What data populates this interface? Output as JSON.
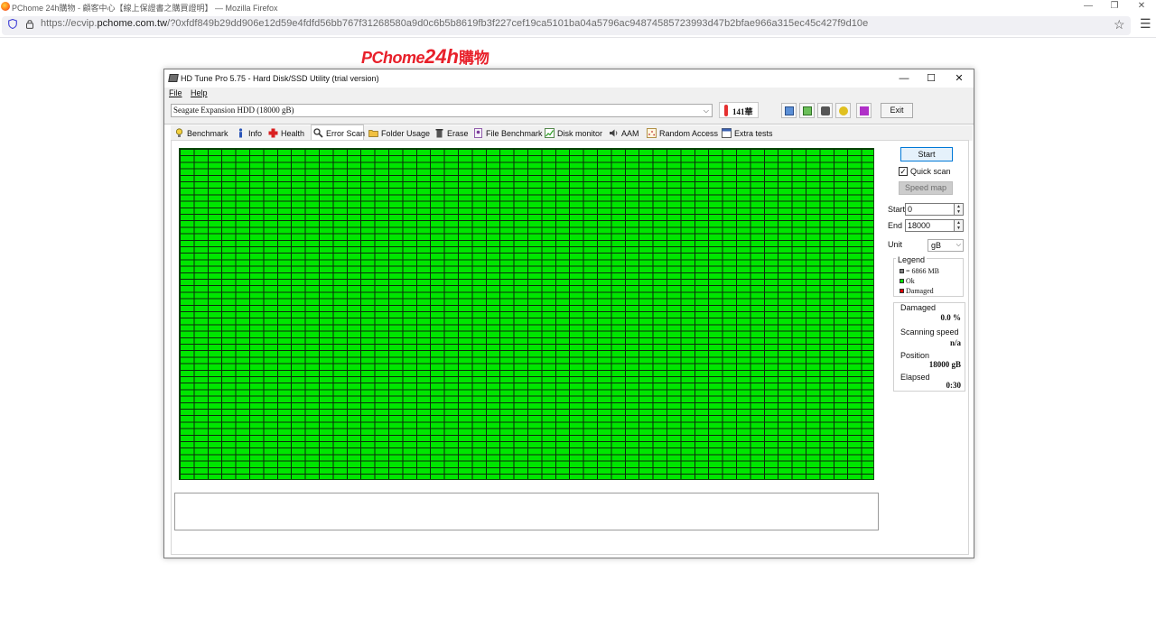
{
  "browser": {
    "title": "PChome 24h購物 - 顧客中心【線上保證書之購買證明】 — Mozilla Firefox",
    "url_host": "https://ecvip.pchome.com.tw",
    "url_host_pre": "https://ecvip.",
    "url_host_domain": "pchome.com.tw",
    "url_path": "/?0xfdf849b29dd906e12d59e4fdfd56bb767f31268580a9d0c6b5b8619fb3f227cef19ca5101ba04a5796ac94874585723993d47b2bfae966a315ec45c427f9d10e",
    "controls": {
      "minimize": "—",
      "restore": "❐",
      "close": "✕"
    },
    "star_icon": "☆",
    "menu_icon": "☰"
  },
  "page": {
    "logo_pc": "PChome",
    "logo_24": "24h",
    "logo_shop": "購物",
    "logo_color": "#e8202a"
  },
  "hdtune": {
    "title": "HD Tune Pro 5.75 - Hard Disk/SSD Utility (trial version)",
    "menu": [
      "File",
      "Help"
    ],
    "drive": "Seagate Expansion HDD (18000 gB)",
    "temperature": "141華",
    "exit_label": "Exit",
    "tabs": [
      {
        "label": "Benchmark",
        "icon": "bulb-icon"
      },
      {
        "label": "Info",
        "icon": "info-icon"
      },
      {
        "label": "Health",
        "icon": "health-cross-icon"
      },
      {
        "label": "Error Scan",
        "icon": "magnifier-icon",
        "active": true
      },
      {
        "label": "Folder Usage",
        "icon": "folder-icon"
      },
      {
        "label": "Erase",
        "icon": "trash-icon"
      },
      {
        "label": "File Benchmark",
        "icon": "file-benchmark-icon"
      },
      {
        "label": "Disk monitor",
        "icon": "chart-icon"
      },
      {
        "label": "AAM",
        "icon": "speaker-icon"
      },
      {
        "label": "Random Access",
        "icon": "random-access-icon"
      },
      {
        "label": "Extra tests",
        "icon": "extra-tests-icon"
      }
    ],
    "error_scan": {
      "start_label": "Start",
      "quick_scan_label": "Quick scan",
      "quick_scan_checked": true,
      "speed_map_label": "Speed map",
      "start_label_field": "Start",
      "start_value": "0",
      "end_label": "End",
      "end_value": "18000",
      "unit_label": "Unit",
      "unit_value": "gB",
      "legend_title": "Legend",
      "legend": [
        {
          "label": "= 6866 MB",
          "color": "#808080"
        },
        {
          "label": "Ok",
          "color": "#00e600"
        },
        {
          "label": "Damaged",
          "color": "#e00000"
        }
      ],
      "stats": {
        "damaged_label": "Damaged",
        "damaged_value": "0.0 %",
        "speed_label": "Scanning speed",
        "speed_value": "n/a",
        "position_label": "Position",
        "position_value": "18000 gB",
        "elapsed_label": "Elapsed",
        "elapsed_value": "0:30"
      },
      "grid_color_ok": "#00e600",
      "scanned_fraction": 1.0
    }
  }
}
